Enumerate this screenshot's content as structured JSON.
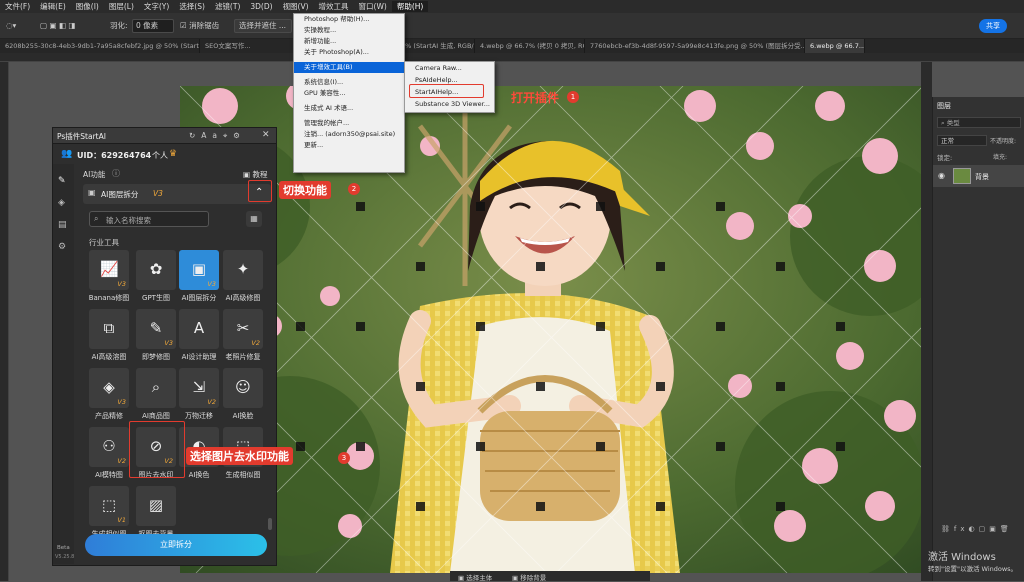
{
  "menubar": [
    "文件(F)",
    "编辑(E)",
    "图像(I)",
    "图层(L)",
    "文字(Y)",
    "选择(S)",
    "滤镜(T)",
    "3D(D)",
    "视图(V)",
    "增效工具",
    "窗口(W)",
    "帮助(H)"
  ],
  "options": {
    "feather_label": "羽化:",
    "feather_value": "0 像素",
    "antialias": "消除锯齿",
    "select_mask": "选择并遮住 ...",
    "share": "共享"
  },
  "tabs": [
    "6208b255-30c8-4eb3-9db1-7a95a8cfebf2.jpg @ 50% (StartAI 生成, ...",
    "SEO文案写作...",
    "SEO文案写作 (1).png @ 33.3% (StartAI 生成, RGB/8...",
    "4.webp @ 66.7% (拷贝 0 拷贝, RGB/8...",
    "7760ebcb-ef3b-4d8f-9597-5a99e8c413fe.png @ 50% (图层拆分受...",
    "6.webp @ 66.7..."
  ],
  "help_menu": {
    "items": [
      "Photoshop 帮助(H)...",
      "实操教程...",
      "新增功能...",
      "关于 Photoshop(A)...",
      "关于增效工具(B)",
      "系统信息(I)...",
      "GPU 兼容性...",
      "生成式 AI 术语...",
      "管理我的帐户...",
      "注销... (adorn350@psai.site)",
      "更新..."
    ],
    "highlighted": "关于增效工具(B)"
  },
  "submenu": {
    "items": [
      "Camera Raw...",
      "PsAIdeHelp...",
      "StartAIHelp...",
      "Substance 3D Viewer..."
    ]
  },
  "plugin": {
    "title": "Ps插件StartAI",
    "uid": "UID：629264764",
    "plan": "个人",
    "ai_func": "AI功能",
    "tutorial": "教程",
    "module": "AI图层拆分",
    "module_ver": "V3",
    "search_placeholder": "输入名称搜索",
    "section": "行业工具",
    "tools": [
      {
        "label": "Banana修图",
        "ver": "V3",
        "icon": "📈"
      },
      {
        "label": "GPT生图",
        "ver": "",
        "icon": "✿"
      },
      {
        "label": "AI图层拆分",
        "ver": "V3",
        "icon": "▣"
      },
      {
        "label": "AI高级修图",
        "ver": "",
        "icon": "✦"
      },
      {
        "label": "AI高级溶图",
        "ver": "",
        "icon": "⧉"
      },
      {
        "label": "即梦修图",
        "ver": "V3",
        "icon": "✎"
      },
      {
        "label": "AI设计助理",
        "ver": "",
        "icon": "A"
      },
      {
        "label": "老照片修复",
        "ver": "V2",
        "icon": "✂"
      },
      {
        "label": "产品精修",
        "ver": "V3",
        "icon": "◈"
      },
      {
        "label": "AI商品图",
        "ver": "",
        "icon": "⌕"
      },
      {
        "label": "万物迁移",
        "ver": "V2",
        "icon": "⇲"
      },
      {
        "label": "AI换脸",
        "ver": "",
        "icon": "☺"
      },
      {
        "label": "AI模特图",
        "ver": "V2",
        "icon": "⚇"
      },
      {
        "label": "图片去水印",
        "ver": "V2",
        "icon": "⊘"
      },
      {
        "label": "AI换色",
        "ver": "V2",
        "icon": "◐"
      },
      {
        "label": "生成相似图",
        "ver": "",
        "icon": "⬚"
      },
      {
        "label": "生成相似图",
        "ver": "V1",
        "icon": "⬚"
      },
      {
        "label": "抠图去背景",
        "ver": "",
        "icon": "▨"
      }
    ],
    "action_button": "立即拆分",
    "footer_brand": "Beta",
    "footer_version": "V5.25.8"
  },
  "callouts": {
    "c1": "打开插件",
    "c2": "切换功能",
    "c3": "选择图片去水印功能",
    "n1": "1",
    "n2": "2",
    "n3": "3"
  },
  "layers_panel": {
    "title": "图层",
    "search": "类型",
    "mode": "正常",
    "opacity_label": "不透明度:",
    "lock_label": "锁定:",
    "fill_label": "填充:",
    "layer_name": "背景"
  },
  "statusbar": {
    "a": "选择主体",
    "b": "移除背景"
  },
  "watermark": {
    "line1": "激活 Windows",
    "line2": "转到\"设置\"以激活 Windows。"
  },
  "colors": {
    "accent": "#2e8cd9",
    "callout": "#e23b2e",
    "version": "#f0a83a"
  }
}
